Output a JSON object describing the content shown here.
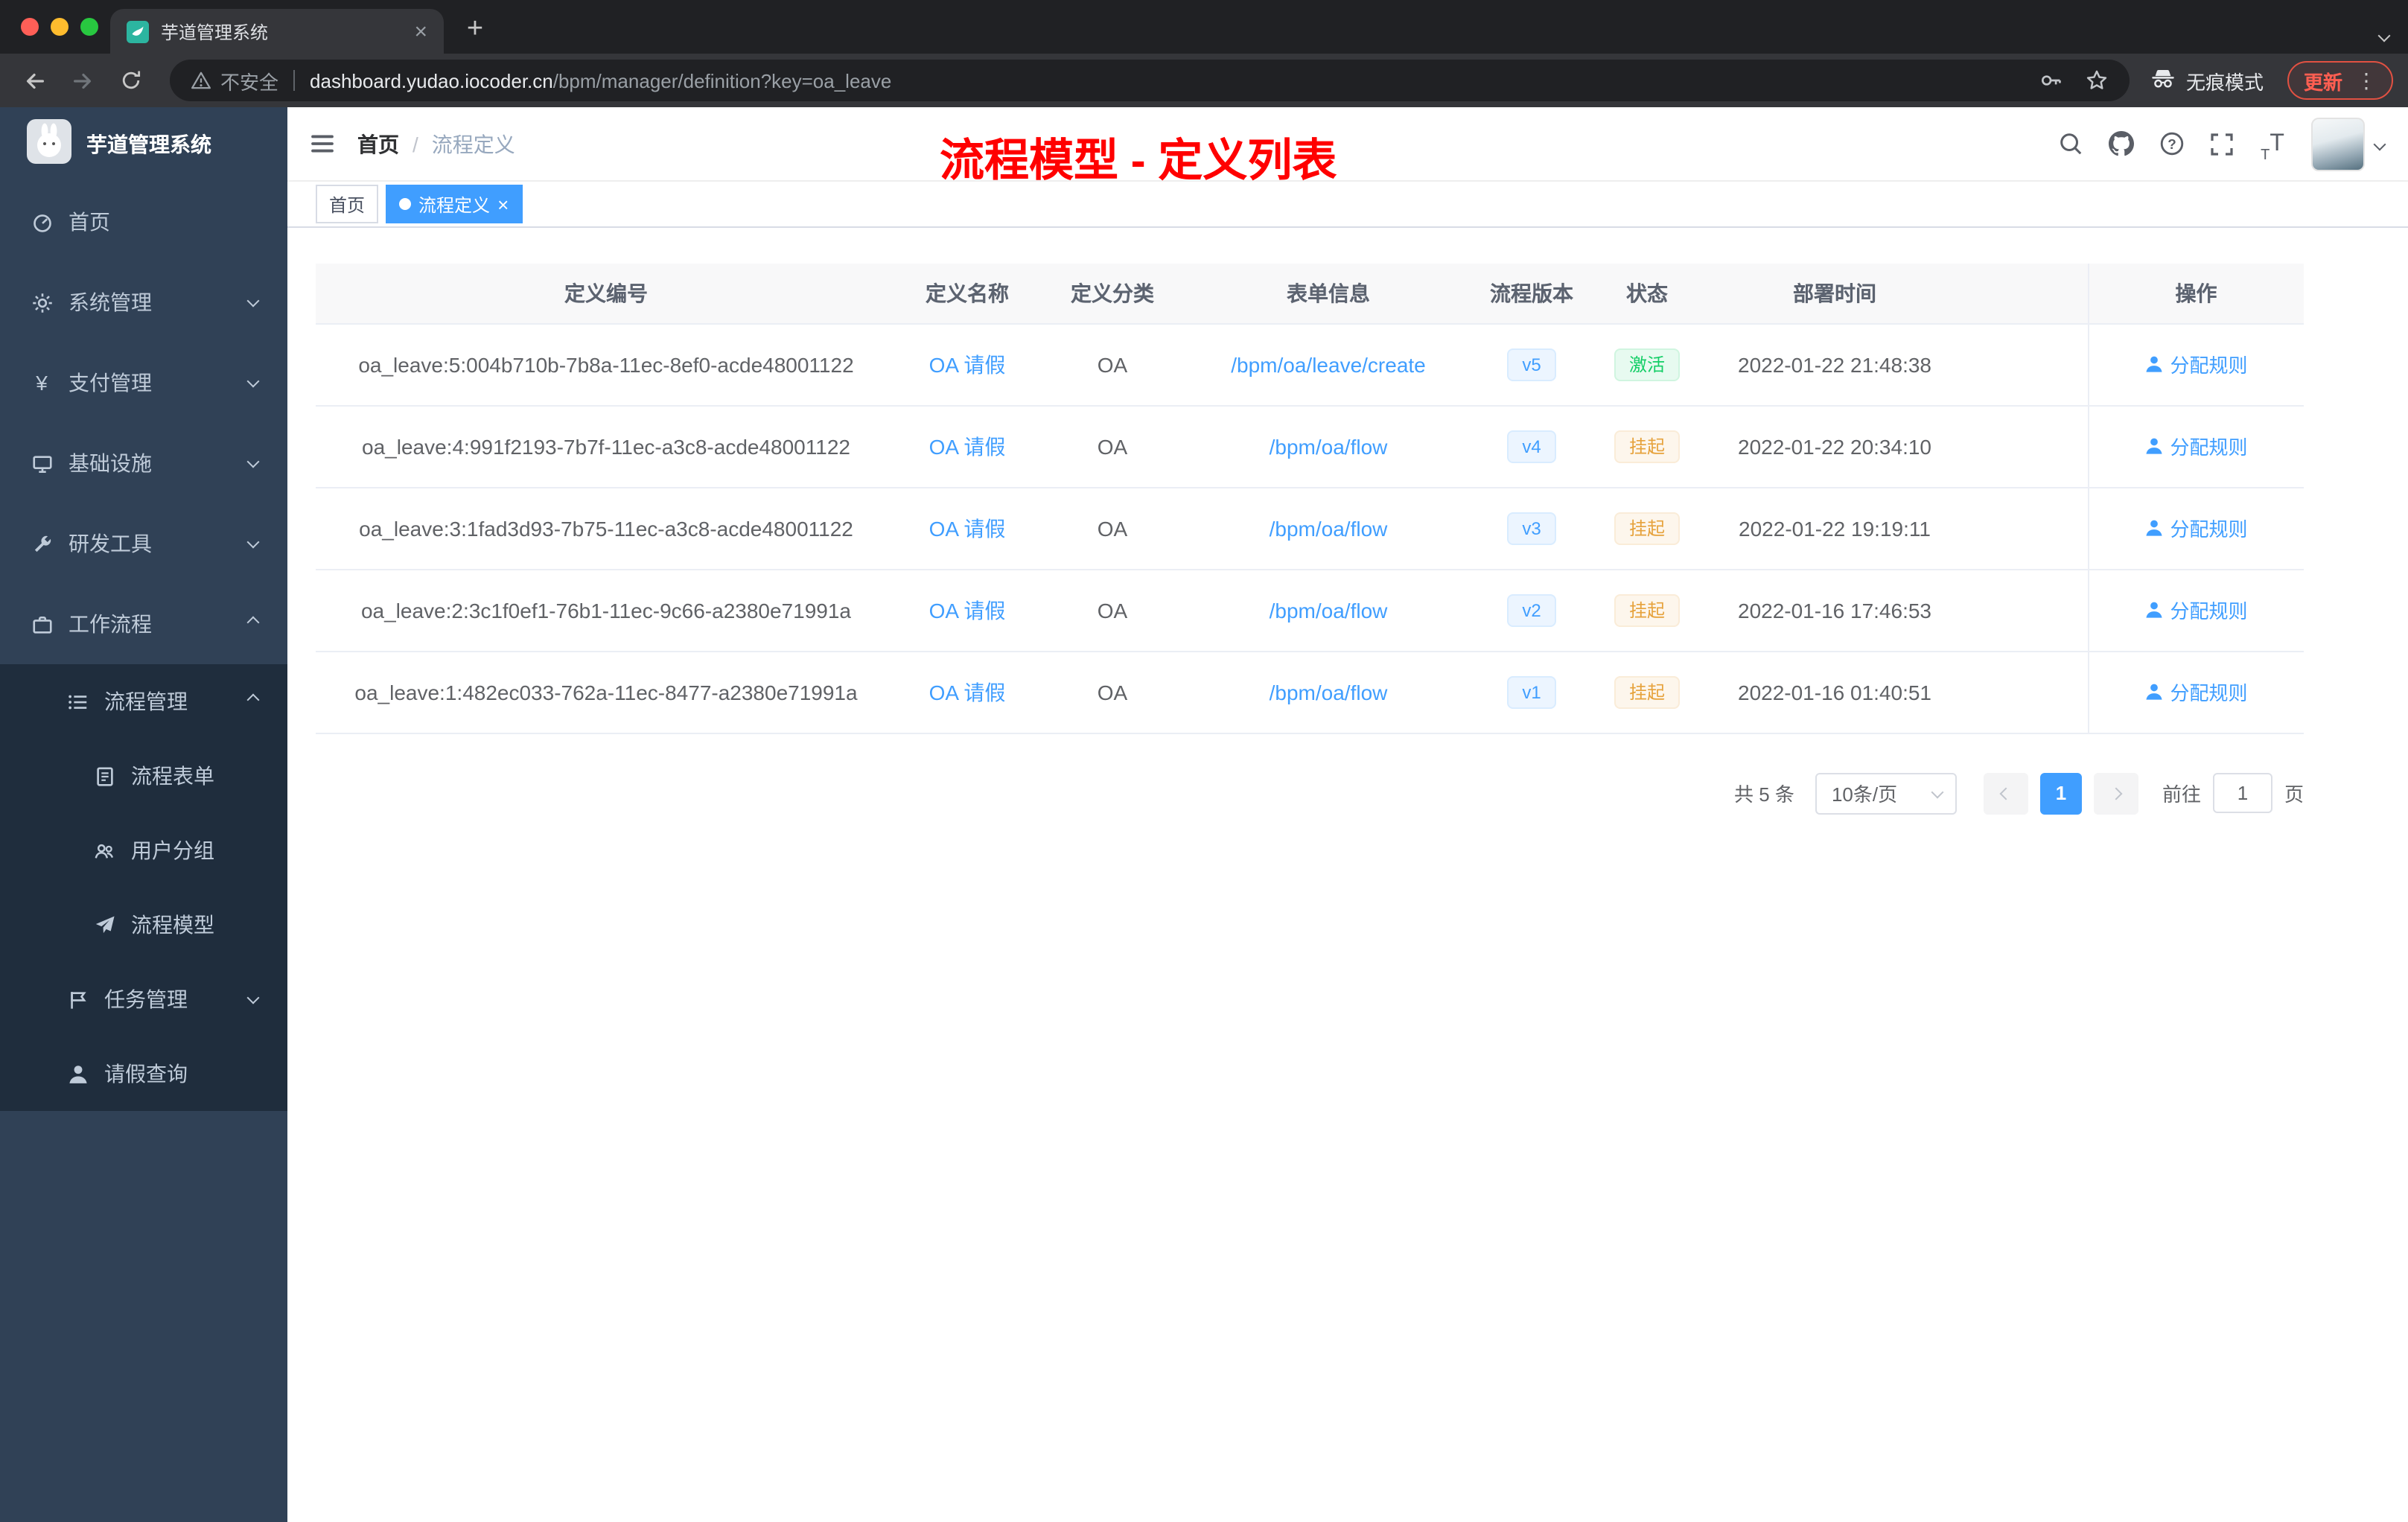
{
  "browser": {
    "tab_title": "芋道管理系统",
    "security_label": "不安全",
    "url_host": "dashboard.yudao.iocoder.cn",
    "url_path": "/bpm/manager/definition?key=oa_leave",
    "incognito_label": "无痕模式",
    "update_label": "更新"
  },
  "sidebar": {
    "logo_title": "芋道管理系统",
    "items": [
      {
        "key": "home",
        "label": "首页",
        "icon": "dashboard-icon",
        "level": 1
      },
      {
        "key": "system-management",
        "label": "系统管理",
        "icon": "gear-icon",
        "level": 1,
        "chevron": "down"
      },
      {
        "key": "payment-management",
        "label": "支付管理",
        "icon": "payment-icon",
        "level": 1,
        "chevron": "down"
      },
      {
        "key": "infrastructure",
        "label": "基础设施",
        "icon": "infrastructure-icon",
        "level": 1,
        "chevron": "down"
      },
      {
        "key": "devtools",
        "label": "研发工具",
        "icon": "devtools-icon",
        "level": 1,
        "chevron": "down"
      },
      {
        "key": "workflow",
        "label": "工作流程",
        "icon": "workflow-icon",
        "level": 1,
        "chevron": "up"
      },
      {
        "key": "process-management",
        "label": "流程管理",
        "icon": "process-list-icon",
        "level": 2,
        "chevron": "up",
        "dark": true
      },
      {
        "key": "process-form",
        "label": "流程表单",
        "icon": "form-icon",
        "level": 3,
        "dark": true
      },
      {
        "key": "user-group",
        "label": "用户分组",
        "icon": "user-group-icon",
        "level": 3,
        "dark": true
      },
      {
        "key": "process-model",
        "label": "流程模型",
        "icon": "model-icon",
        "level": 3,
        "dark": true
      },
      {
        "key": "task-management",
        "label": "任务管理",
        "icon": "task-icon",
        "level": 2,
        "chevron": "down",
        "dark": true
      },
      {
        "key": "leave-query",
        "label": "请假查询",
        "icon": "user-icon",
        "level": 2,
        "dark": true
      }
    ]
  },
  "header": {
    "breadcrumb": [
      "首页",
      "流程定义"
    ],
    "annotation": "流程模型 - 定义列表"
  },
  "tags": [
    {
      "label": "首页",
      "active": false
    },
    {
      "label": "流程定义",
      "active": true
    }
  ],
  "table": {
    "columns": [
      "定义编号",
      "定义名称",
      "定义分类",
      "表单信息",
      "流程版本",
      "状态",
      "部署时间",
      "操作"
    ],
    "rows": [
      {
        "id": "oa_leave:5:004b710b-7b8a-11ec-8ef0-acde48001122",
        "name": "OA 请假",
        "category": "OA",
        "form": "/bpm/oa/leave/create",
        "version": "v5",
        "status": "激活",
        "status_type": "success",
        "deployed_at": "2022-01-22 21:48:38",
        "action": "分配规则"
      },
      {
        "id": "oa_leave:4:991f2193-7b7f-11ec-a3c8-acde48001122",
        "name": "OA 请假",
        "category": "OA",
        "form": "/bpm/oa/flow",
        "version": "v4",
        "status": "挂起",
        "status_type": "warning",
        "deployed_at": "2022-01-22 20:34:10",
        "action": "分配规则"
      },
      {
        "id": "oa_leave:3:1fad3d93-7b75-11ec-a3c8-acde48001122",
        "name": "OA 请假",
        "category": "OA",
        "form": "/bpm/oa/flow",
        "version": "v3",
        "status": "挂起",
        "status_type": "warning",
        "deployed_at": "2022-01-22 19:19:11",
        "action": "分配规则"
      },
      {
        "id": "oa_leave:2:3c1f0ef1-76b1-11ec-9c66-a2380e71991a",
        "name": "OA 请假",
        "category": "OA",
        "form": "/bpm/oa/flow",
        "version": "v2",
        "status": "挂起",
        "status_type": "warning",
        "deployed_at": "2022-01-16 17:46:53",
        "action": "分配规则"
      },
      {
        "id": "oa_leave:1:482ec033-762a-11ec-8477-a2380e71991a",
        "name": "OA 请假",
        "category": "OA",
        "form": "/bpm/oa/flow",
        "version": "v1",
        "status": "挂起",
        "status_type": "warning",
        "deployed_at": "2022-01-16 01:40:51",
        "action": "分配规则"
      }
    ]
  },
  "pagination": {
    "total_label": "共 5 条",
    "page_size_label": "10条/页",
    "current_page": "1",
    "goto_label": "前往",
    "goto_value": "1",
    "page_unit_label": "页"
  },
  "colors": {
    "accent": "#409eff",
    "success": "#13ce66",
    "warning": "#e6a23c",
    "annotation-red": "#ff0000",
    "sidebar-bg": "#304156",
    "submenu-bg": "#1f2d3d",
    "sidebar-text": "#bfcbd9"
  }
}
